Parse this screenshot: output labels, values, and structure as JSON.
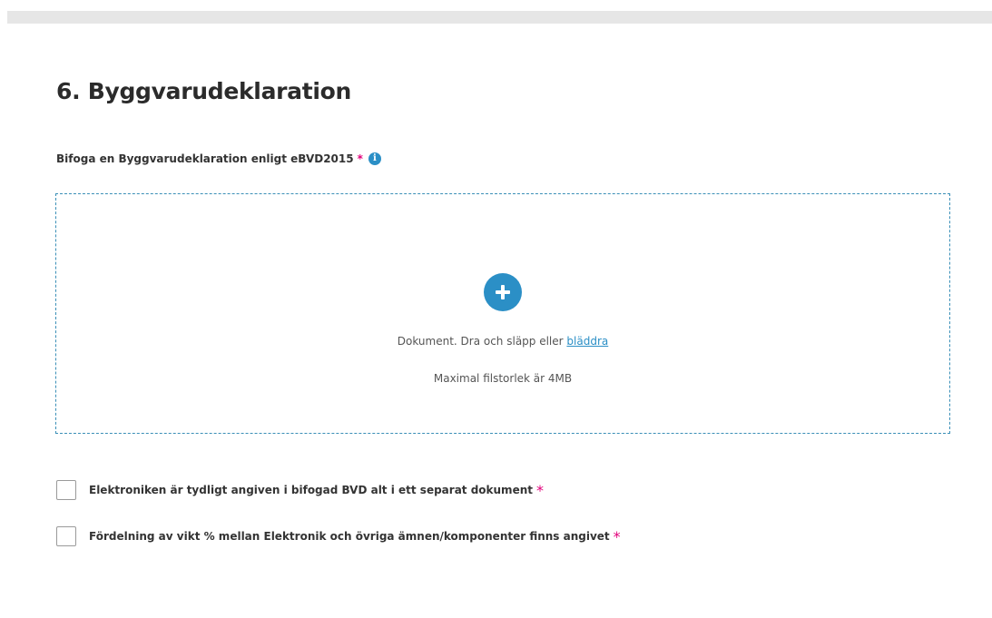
{
  "section": {
    "title": "6. Byggvarudeklaration"
  },
  "upload": {
    "label": "Bifoga en Byggvarudeklaration enligt eBVD2015",
    "required_mark": "*",
    "info_glyph": "i",
    "dropzone_text": "Dokument. Dra och släpp eller",
    "browse_link": "bläddra",
    "max_size_text": "Maximal filstorlek är 4MB"
  },
  "checkboxes": [
    {
      "label": "Elektroniken är tydligt angiven i bifogad BVD alt i ett separat dokument",
      "required_mark": "*",
      "checked": false
    },
    {
      "label": "Fördelning av vikt % mellan Elektronik och övriga ämnen/komponenter finns angivet",
      "required_mark": "*",
      "checked": false
    }
  ],
  "icons": {
    "info": "info-icon",
    "add": "plus-circle-icon"
  },
  "colors": {
    "accent": "#2b8fc6",
    "required": "#e2007a",
    "dropzone_border": "#3a8fb7"
  }
}
